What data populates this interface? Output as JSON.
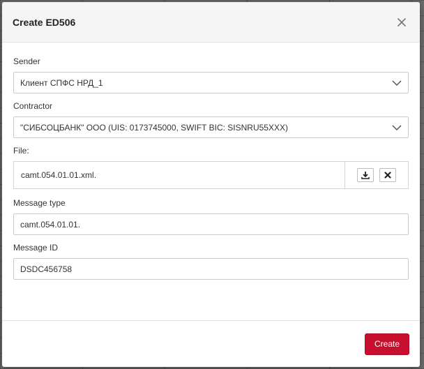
{
  "dialog": {
    "title": "Create ED506"
  },
  "form": {
    "sender": {
      "label": "Sender",
      "value": "Клиент СПФС НРД_1"
    },
    "contractor": {
      "label": "Contractor",
      "value": "\"СИБСОЦБАНК\" ООО (UIS: 0173745000, SWIFT BIC: SISNRU55XXX)"
    },
    "file": {
      "label": "File:",
      "name": "camt.054.01.01.xml."
    },
    "message_type": {
      "label": "Message type",
      "value": "camt.054.01.01."
    },
    "message_id": {
      "label": "Message ID",
      "value": "DSDC456758"
    }
  },
  "footer": {
    "create_label": "Create"
  },
  "colors": {
    "primary": "#c8102e",
    "header_bg": "#f5f5f5",
    "border": "#c9c9c9"
  },
  "icons": {
    "close": "close-icon",
    "dropdown": "chevron-down-icon",
    "download": "download-icon",
    "remove": "remove-icon"
  }
}
